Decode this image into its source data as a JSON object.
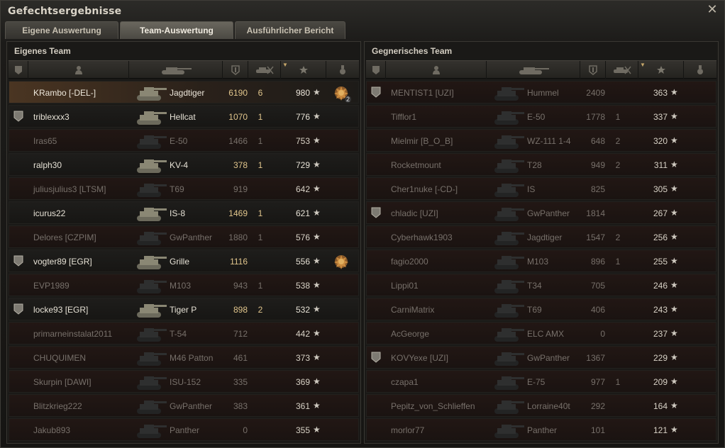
{
  "window": {
    "title": "Gefechtsergebnisse"
  },
  "tabs": [
    {
      "label": "Eigene Auswertung"
    },
    {
      "label": "Team-Auswertung"
    },
    {
      "label": "Ausführlicher Bericht"
    }
  ],
  "active_tab": 1,
  "colors": {
    "accent_dmg": "#e0c58c",
    "dead_text": "#77706a",
    "alive_text": "#e6e1d5"
  },
  "own_team": {
    "title": "Eigenes Team",
    "rows": [
      {
        "name": "KRambo [-DEL-]",
        "vehicle": "Jagdtiger",
        "damage": "6190",
        "kills": "6",
        "xp": "980",
        "status": "me",
        "platoon": false,
        "medal": "medal-icon",
        "medal_count": "2"
      },
      {
        "name": "triblexxx3",
        "vehicle": "Hellcat",
        "damage": "1070",
        "kills": "1",
        "xp": "776",
        "status": "alive",
        "platoon": true,
        "medal": "",
        "medal_count": ""
      },
      {
        "name": "Iras65",
        "vehicle": "E-50",
        "damage": "1466",
        "kills": "1",
        "xp": "753",
        "status": "dead",
        "platoon": false,
        "medal": "",
        "medal_count": ""
      },
      {
        "name": "ralph30",
        "vehicle": "KV-4",
        "damage": "378",
        "kills": "1",
        "xp": "729",
        "status": "alive",
        "platoon": false,
        "medal": "",
        "medal_count": ""
      },
      {
        "name": "juliusjulius3 [LTSM]",
        "vehicle": "T69",
        "damage": "919",
        "kills": "",
        "xp": "642",
        "status": "dead",
        "platoon": false,
        "medal": "",
        "medal_count": ""
      },
      {
        "name": "icurus22",
        "vehicle": "IS-8",
        "damage": "1469",
        "kills": "1",
        "xp": "621",
        "status": "alive",
        "platoon": false,
        "medal": "",
        "medal_count": ""
      },
      {
        "name": "Delores [CZPIM]",
        "vehicle": "GwPanther",
        "damage": "1880",
        "kills": "1",
        "xp": "576",
        "status": "dead",
        "platoon": false,
        "medal": "",
        "medal_count": ""
      },
      {
        "name": "vogter89 [EGR]",
        "vehicle": "Grille",
        "damage": "1116",
        "kills": "",
        "xp": "556",
        "status": "alive",
        "platoon": true,
        "medal": "medal-icon",
        "medal_count": ""
      },
      {
        "name": "EVP1989",
        "vehicle": "M103",
        "damage": "943",
        "kills": "1",
        "xp": "538",
        "status": "dead",
        "platoon": false,
        "medal": "",
        "medal_count": ""
      },
      {
        "name": "locke93 [EGR]",
        "vehicle": "Tiger P",
        "damage": "898",
        "kills": "2",
        "xp": "532",
        "status": "alive",
        "platoon": true,
        "medal": "",
        "medal_count": ""
      },
      {
        "name": "primarneinstalat2011",
        "vehicle": "T-54",
        "damage": "712",
        "kills": "",
        "xp": "442",
        "status": "dead",
        "platoon": false,
        "medal": "",
        "medal_count": ""
      },
      {
        "name": "CHUQUIMEN",
        "vehicle": "M46 Patton",
        "damage": "461",
        "kills": "",
        "xp": "373",
        "status": "dead",
        "platoon": false,
        "medal": "",
        "medal_count": ""
      },
      {
        "name": "Skurpin [DAWI]",
        "vehicle": "ISU-152",
        "damage": "335",
        "kills": "",
        "xp": "369",
        "status": "dead",
        "platoon": false,
        "medal": "",
        "medal_count": ""
      },
      {
        "name": "Blitzkrieg222",
        "vehicle": "GwPanther",
        "damage": "383",
        "kills": "",
        "xp": "361",
        "status": "dead",
        "platoon": false,
        "medal": "",
        "medal_count": ""
      },
      {
        "name": "Jakub893",
        "vehicle": "Panther",
        "damage": "0",
        "kills": "",
        "xp": "355",
        "status": "dead",
        "platoon": false,
        "medal": "",
        "medal_count": ""
      }
    ]
  },
  "enemy_team": {
    "title": "Gegnerisches Team",
    "rows": [
      {
        "name": "MENTIST1 [UZI]",
        "vehicle": "Hummel",
        "damage": "2409",
        "kills": "",
        "xp": "363",
        "status": "dead",
        "platoon": true
      },
      {
        "name": "Tifflor1",
        "vehicle": "E-50",
        "damage": "1778",
        "kills": "1",
        "xp": "337",
        "status": "dead",
        "platoon": false
      },
      {
        "name": "Mielmir [B_O_B]",
        "vehicle": "WZ-111 1-4",
        "damage": "648",
        "kills": "2",
        "xp": "320",
        "status": "dead",
        "platoon": false
      },
      {
        "name": "Rocketmount",
        "vehicle": "T28",
        "damage": "949",
        "kills": "2",
        "xp": "311",
        "status": "dead",
        "platoon": false
      },
      {
        "name": "Cher1nuke [-CD-]",
        "vehicle": "IS",
        "damage": "825",
        "kills": "",
        "xp": "305",
        "status": "dead",
        "platoon": false
      },
      {
        "name": "chladic [UZI]",
        "vehicle": "GwPanther",
        "damage": "1814",
        "kills": "",
        "xp": "267",
        "status": "dead",
        "platoon": true
      },
      {
        "name": "Cyberhawk1903",
        "vehicle": "Jagdtiger",
        "damage": "1547",
        "kills": "2",
        "xp": "256",
        "status": "dead",
        "platoon": false
      },
      {
        "name": "fagio2000",
        "vehicle": "M103",
        "damage": "896",
        "kills": "1",
        "xp": "255",
        "status": "dead",
        "platoon": false
      },
      {
        "name": "Lippi01",
        "vehicle": "T34",
        "damage": "705",
        "kills": "",
        "xp": "246",
        "status": "dead",
        "platoon": false
      },
      {
        "name": "CarniMatrix",
        "vehicle": "T69",
        "damage": "406",
        "kills": "",
        "xp": "243",
        "status": "dead",
        "platoon": false
      },
      {
        "name": "AcGeorge",
        "vehicle": "ELC AMX",
        "damage": "0",
        "kills": "",
        "xp": "237",
        "status": "dead",
        "platoon": false
      },
      {
        "name": "KOVYexe [UZI]",
        "vehicle": "GwPanther",
        "damage": "1367",
        "kills": "",
        "xp": "229",
        "status": "dead",
        "platoon": true
      },
      {
        "name": "czapa1",
        "vehicle": "E-75",
        "damage": "977",
        "kills": "1",
        "xp": "209",
        "status": "dead",
        "platoon": false
      },
      {
        "name": "Pepitz_von_Schlieffen",
        "vehicle": "Lorraine40t",
        "damage": "292",
        "kills": "",
        "xp": "164",
        "status": "dead",
        "platoon": false
      },
      {
        "name": "morlor77",
        "vehicle": "Panther",
        "damage": "101",
        "kills": "",
        "xp": "121",
        "status": "dead",
        "platoon": false
      }
    ]
  },
  "columns": {
    "icons": [
      "platoon-icon",
      "player-icon",
      "vehicle-icon",
      "damage-icon",
      "kills-icon",
      "xp-icon",
      "medal-icon"
    ],
    "sort_column": "xp",
    "star_glyph": "★"
  }
}
